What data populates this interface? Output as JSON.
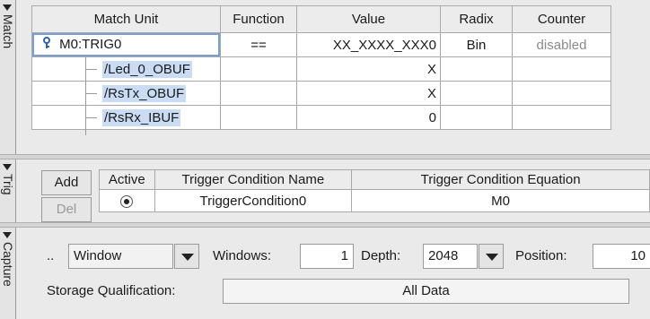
{
  "tabs": {
    "match": "Match",
    "trig": "Trig",
    "capture": "Capture"
  },
  "match": {
    "headers": [
      "Match Unit",
      "Function",
      "Value",
      "Radix",
      "Counter"
    ],
    "rows": [
      {
        "unit": "M0:TRIG0",
        "function": "==",
        "value": "XX_XXXX_XXX0",
        "radix": "Bin",
        "counter": "disabled"
      },
      {
        "unit": "/Led_0_OBUF",
        "function": "",
        "value": "X",
        "radix": "",
        "counter": ""
      },
      {
        "unit": "/RsTx_OBUF",
        "function": "",
        "value": "X",
        "radix": "",
        "counter": ""
      },
      {
        "unit": "/RsRx_IBUF",
        "function": "",
        "value": "0",
        "radix": "",
        "counter": ""
      }
    ]
  },
  "trig": {
    "add_label": "Add",
    "del_label": "Del",
    "headers": [
      "Active",
      "Trigger Condition Name",
      "Trigger Condition Equation"
    ],
    "row": {
      "name": "TriggerCondition0",
      "equation": "M0"
    }
  },
  "capture": {
    "dots": "..",
    "mode_value": "Window",
    "windows_label": "Windows:",
    "windows_value": "1",
    "depth_label": "Depth:",
    "depth_value": "2048",
    "position_label": "Position:",
    "position_value": "10",
    "storage_label": "Storage Qualification:",
    "storage_value": "All Data"
  },
  "colors": {
    "selection": "#c9dcf3",
    "focus_border": "#7a9fd6"
  },
  "icons": {
    "tree_node": "key-node-icon",
    "dropdown": "chevron-down-icon"
  }
}
